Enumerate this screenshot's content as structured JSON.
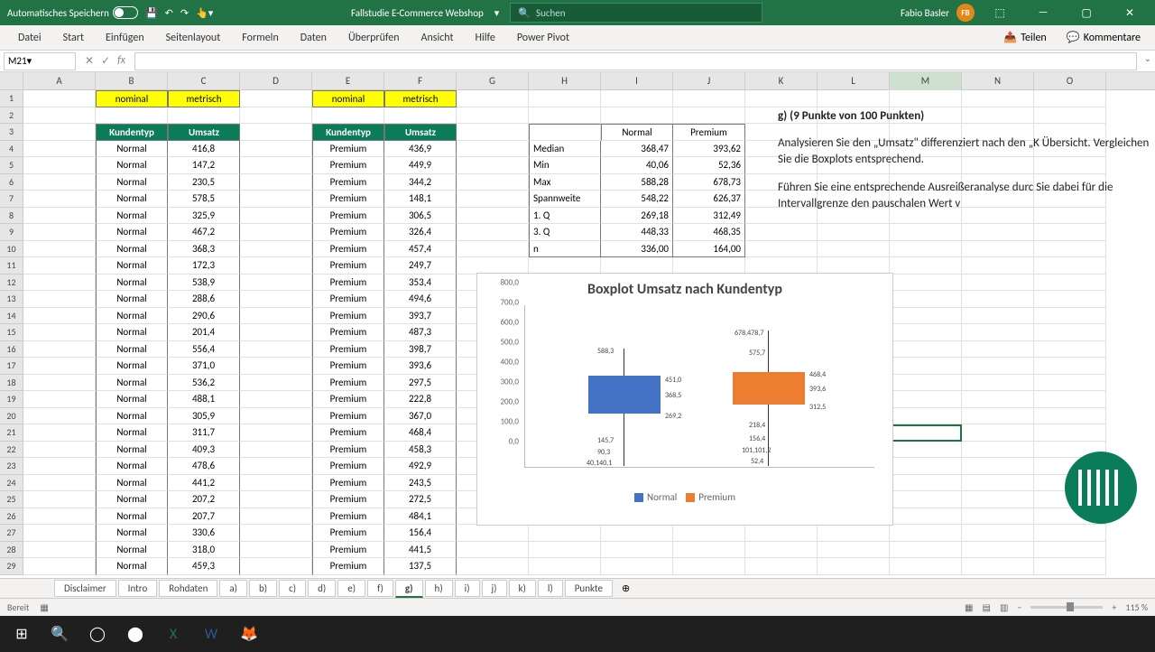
{
  "title_bar": {
    "autosave": "Automatisches Speichern",
    "doc": "Fallstudie E-Commerce Webshop",
    "search_ph": "Suchen",
    "user": "Fabio Basler",
    "badge": "FB"
  },
  "ribbon": [
    "Datei",
    "Start",
    "Einfügen",
    "Seitenlayout",
    "Formeln",
    "Daten",
    "Überprüfen",
    "Ansicht",
    "Hilfe",
    "Power Pivot"
  ],
  "share": "Teilen",
  "comments": "Kommentare",
  "name_box": "M21",
  "cols": [
    "A",
    "B",
    "C",
    "D",
    "E",
    "F",
    "G",
    "H",
    "I",
    "J",
    "K",
    "L",
    "M",
    "N",
    "O"
  ],
  "hdr": {
    "nominal": "nominal",
    "metrisch": "metrisch",
    "kundentyp": "Kundentyp",
    "umsatz": "Umsatz"
  },
  "t1": [
    [
      "Normal",
      "416,8"
    ],
    [
      "Normal",
      "147,2"
    ],
    [
      "Normal",
      "230,5"
    ],
    [
      "Normal",
      "578,5"
    ],
    [
      "Normal",
      "325,9"
    ],
    [
      "Normal",
      "467,2"
    ],
    [
      "Normal",
      "368,3"
    ],
    [
      "Normal",
      "172,3"
    ],
    [
      "Normal",
      "538,9"
    ],
    [
      "Normal",
      "288,6"
    ],
    [
      "Normal",
      "290,6"
    ],
    [
      "Normal",
      "201,4"
    ],
    [
      "Normal",
      "556,4"
    ],
    [
      "Normal",
      "371,0"
    ],
    [
      "Normal",
      "536,2"
    ],
    [
      "Normal",
      "488,1"
    ],
    [
      "Normal",
      "305,9"
    ],
    [
      "Normal",
      "311,7"
    ],
    [
      "Normal",
      "409,3"
    ],
    [
      "Normal",
      "478,6"
    ],
    [
      "Normal",
      "441,2"
    ],
    [
      "Normal",
      "207,2"
    ],
    [
      "Normal",
      "207,7"
    ],
    [
      "Normal",
      "330,6"
    ],
    [
      "Normal",
      "318,0"
    ],
    [
      "Normal",
      "459,3"
    ]
  ],
  "t2": [
    [
      "Premium",
      "436,9"
    ],
    [
      "Premium",
      "449,9"
    ],
    [
      "Premium",
      "344,2"
    ],
    [
      "Premium",
      "148,1"
    ],
    [
      "Premium",
      "306,5"
    ],
    [
      "Premium",
      "326,4"
    ],
    [
      "Premium",
      "457,4"
    ],
    [
      "Premium",
      "249,7"
    ],
    [
      "Premium",
      "353,4"
    ],
    [
      "Premium",
      "494,6"
    ],
    [
      "Premium",
      "393,7"
    ],
    [
      "Premium",
      "487,3"
    ],
    [
      "Premium",
      "398,7"
    ],
    [
      "Premium",
      "393,6"
    ],
    [
      "Premium",
      "297,5"
    ],
    [
      "Premium",
      "222,8"
    ],
    [
      "Premium",
      "367,0"
    ],
    [
      "Premium",
      "468,4"
    ],
    [
      "Premium",
      "458,3"
    ],
    [
      "Premium",
      "492,9"
    ],
    [
      "Premium",
      "243,5"
    ],
    [
      "Premium",
      "272,5"
    ],
    [
      "Premium",
      "484,1"
    ],
    [
      "Premium",
      "156,4"
    ],
    [
      "Premium",
      "441,5"
    ],
    [
      "Premium",
      "137,5"
    ]
  ],
  "stats": {
    "h": [
      "",
      "Normal",
      "Premium"
    ],
    "rows": [
      [
        "Median",
        "368,47",
        "393,62"
      ],
      [
        "Min",
        "40,06",
        "52,36"
      ],
      [
        "Max",
        "588,28",
        "678,73"
      ],
      [
        "Spannweite",
        "548,22",
        "626,37"
      ],
      [
        "1. Q",
        "269,18",
        "312,49"
      ],
      [
        "3. Q",
        "448,33",
        "468,35"
      ],
      [
        "n",
        "336,00",
        "164,00"
      ]
    ]
  },
  "task": {
    "title": "g) (9 Punkte von 100 Punkten)",
    "p1": "Analysieren Sie den „Umsatz\" differenziert nach den „K Übersicht. Vergleichen Sie die Boxplots entsprechend.",
    "p2": "Führen Sie eine entsprechende Ausreißeranalyse durc Sie dabei für die Intervallgrenze den pauschalen Wert v"
  },
  "chart_data": {
    "type": "boxplot",
    "title": "Boxplot Umsatz nach Kundentyp",
    "ylim": [
      0,
      800
    ],
    "yticks": [
      "0,0",
      "100,0",
      "200,0",
      "300,0",
      "400,0",
      "500,0",
      "600,0",
      "700,0",
      "800,0"
    ],
    "series": [
      {
        "name": "Normal",
        "color": "#4472c4",
        "q1": 269.2,
        "median": 368.5,
        "q3": 451.0,
        "min": 40.1,
        "max": 588.3,
        "labels": [
          "588,3",
          "451,0",
          "368,5",
          "269,2",
          "145,7",
          "90,3",
          "40,140,1"
        ]
      },
      {
        "name": "Premium",
        "color": "#ed7d31",
        "q1": 312.5,
        "median": 393.6,
        "q3": 468.4,
        "min": 52.4,
        "max": 678.7,
        "labels": [
          "678,478,7",
          "575,7",
          "468,4",
          "393,6",
          "312,5",
          "218,4",
          "156,4",
          "101,101,2",
          "52,4"
        ]
      }
    ],
    "legend": [
      "Normal",
      "Premium"
    ]
  },
  "sheet_tabs": [
    "Disclaimer",
    "Intro",
    "Rohdaten",
    "a)",
    "b)",
    "c)",
    "d)",
    "e)",
    "f)",
    "g)",
    "h)",
    "i)",
    "j)",
    "k)",
    "l)",
    "Punkte"
  ],
  "active_tab": "g)",
  "status": {
    "ready": "Bereit",
    "zoom": "115 %"
  }
}
